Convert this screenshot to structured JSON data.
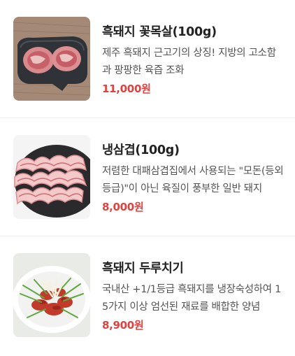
{
  "menu": {
    "items": [
      {
        "name": "흑돼지 꽃목살(100g)",
        "description": "제주 흑돼지 근고기의 상징! 지방의 고소함과 팡팡한 육즙 조화",
        "price": "11,000원",
        "image_icon": "pork-neck-photo"
      },
      {
        "name": "냉삼겹(100g)",
        "description": "저렴한 대패삼겹집에서 사용되는 \"모돈(등외등급)\"이 아닌 육질이 풍부한 일반 돼지",
        "price": "8,000원",
        "image_icon": "frozen-pork-belly-photo"
      },
      {
        "name": "흑돼지 두루치기",
        "description": "국내산 +1/1등급 흑돼지를 냉장숙성하여 15가지 이상 엄선된 재료를 배합한 양념",
        "price": "8,900원",
        "image_icon": "stir-fried-pork-photo"
      }
    ]
  },
  "colors": {
    "price": "#e0433f",
    "title": "#222222",
    "description": "#555555",
    "divider": "#ececec"
  }
}
